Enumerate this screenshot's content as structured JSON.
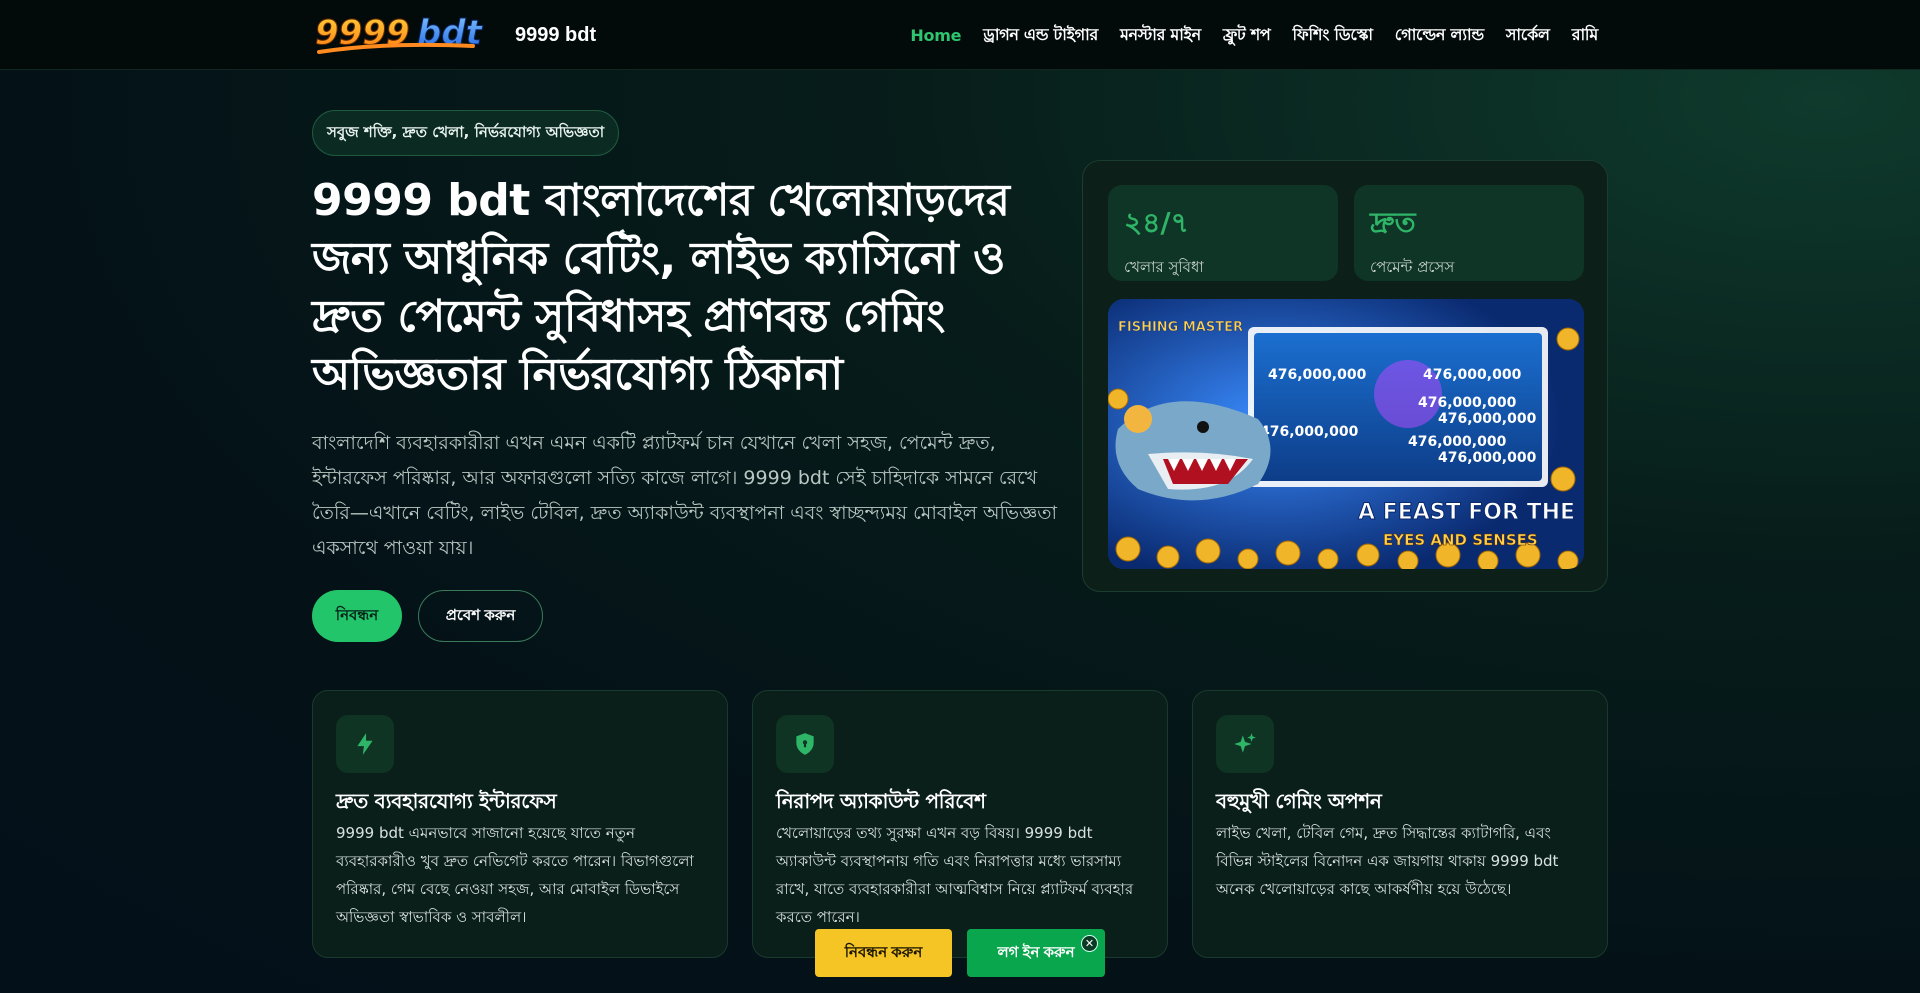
{
  "header": {
    "brand_name": "9999 bdt",
    "logo_text": "9999bdt",
    "nav": [
      {
        "label": "Home"
      },
      {
        "label": "ড্রাগন এন্ড টাইগার"
      },
      {
        "label": "মনস্টার মাইন"
      },
      {
        "label": "ফ্রুট শপ"
      },
      {
        "label": "ফিশিং ডিস্কো"
      },
      {
        "label": "গোল্ডেন ল্যান্ড"
      },
      {
        "label": "সার্কেল"
      },
      {
        "label": "রামি"
      }
    ]
  },
  "hero": {
    "pill": "সবুজ শক্তি, দ্রুত খেলা, নির্ভরযোগ্য অভিজ্ঞতা",
    "title": "9999 bdt বাংলাদেশের খেলোয়াড়দের জন্য আধুনিক বেটিং, লাইভ ক্যাসিনো ও দ্রুত পেমেন্ট সুবিধাসহ প্রাণবন্ত গেমিং অভিজ্ঞতার নির্ভরযোগ্য ঠিকানা",
    "description": "বাংলাদেশি ব্যবহারকারীরা এখন এমন একটি প্ল্যাটফর্ম চান যেখানে খেলা সহজ, পেমেন্ট দ্রুত, ইন্টারফেস পরিষ্কার, আর অফারগুলো সত্যি কাজে লাগে। 9999 bdt সেই চাহিদাকে সামনে রেখে তৈরি—এখানে বেটিং, লাইভ টেবিল, দ্রুত অ্যাকাউন্ট ব্যবস্থাপনা এবং স্বাচ্ছন্দ্যময় মোবাইল অভিজ্ঞতা একসাথে পাওয়া যায়।",
    "register_label": "নিবন্ধন",
    "login_label": "প্রবেশ করুন"
  },
  "stats": [
    {
      "value": "২৪/৭",
      "label": "খেলার সুবিধা"
    },
    {
      "value": "দ্রুত",
      "label": "পেমেন্ট প্রসেস"
    }
  ],
  "game_banner": {
    "logo": "FISHING MASTER",
    "tagline_1": "A FEAST FOR THE",
    "tagline_2": "EYES AND SENSES",
    "numbers": [
      "476,000,000",
      "476,000,000",
      "476,000,000",
      "476,000,000",
      "476,000,000",
      "476,000,000",
      "476,000,000"
    ]
  },
  "features": [
    {
      "icon": "lightning-icon",
      "title": "দ্রুত ব্যবহারযোগ্য ইন্টারফেস",
      "desc": "9999 bdt এমনভাবে সাজানো হয়েছে যাতে নতুন ব্যবহারকারীও খুব দ্রুত নেভিগেট করতে পারেন। বিভাগগুলো পরিষ্কার, গেম বেছে নেওয়া সহজ, আর মোবাইল ডিভাইসে অভিজ্ঞতা স্বাভাবিক ও সাবলীল।"
    },
    {
      "icon": "shield-icon",
      "title": "নিরাপদ অ্যাকাউন্ট পরিবেশ",
      "desc": "খেলোয়াড়ের তথ্য সুরক্ষা এখন বড় বিষয়। 9999 bdt অ্যাকাউন্ট ব্যবস্থাপনায় গতি এবং নিরাপত্তার মধ্যে ভারসাম্য রাখে, যাতে ব্যবহারকারীরা আত্মবিশ্বাস নিয়ে প্ল্যাটফর্ম ব্যবহার করতে পারেন।"
    },
    {
      "icon": "sparkle-icon",
      "title": "বহুমুখী গেমিং অপশন",
      "desc": "লাইভ খেলা, টেবিল গেম, দ্রুত সিদ্ধান্তের ক্যাটাগরি, এবং বিভিন্ন স্টাইলের বিনোদন এক জায়গায় থাকায় 9999 bdt অনেক খেলোয়াড়ের কাছে আকর্ষণীয় হয়ে উঠেছে।"
    }
  ],
  "floating_bar": {
    "register_label": "নিবন্ধন করুন",
    "login_label": "লগ ইন করুন",
    "close_symbol": "✕"
  },
  "colors": {
    "accent_green": "#22c56a",
    "nav_active": "#2fc46f",
    "float_register": "#f4c524",
    "float_login": "#0aa64e"
  }
}
